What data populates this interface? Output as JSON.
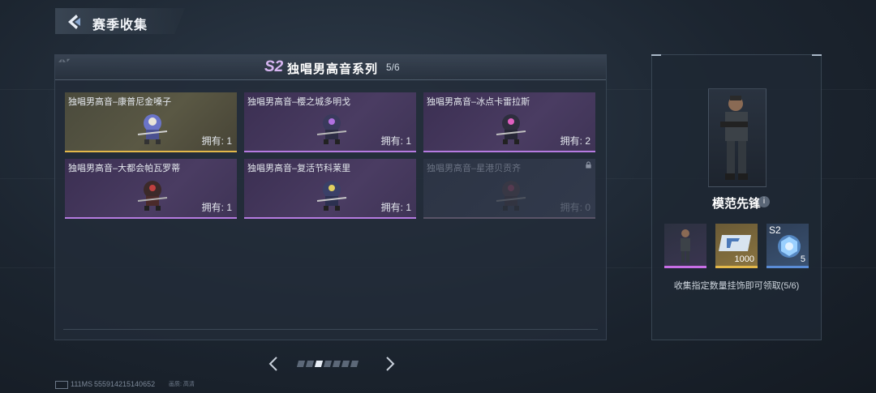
{
  "header": {
    "title": "赛季收集"
  },
  "panel": {
    "season_badge": "S2",
    "title": "独唱男高音系列",
    "count": "5/6"
  },
  "cards": [
    {
      "name": "独唱男高音–康普尼金嗓子",
      "own": "拥有: 1",
      "rarity": "gold",
      "locked": false
    },
    {
      "name": "独唱男高音–樱之城多明戈",
      "own": "拥有: 1",
      "rarity": "purple",
      "locked": false
    },
    {
      "name": "独唱男高音–冰点卡雷拉斯",
      "own": "拥有: 2",
      "rarity": "purple",
      "locked": false
    },
    {
      "name": "独唱男高音–大都会帕瓦罗蒂",
      "own": "拥有: 1",
      "rarity": "purple",
      "locked": false
    },
    {
      "name": "独唱男高音–复活节科莱里",
      "own": "拥有: 1",
      "rarity": "purple",
      "locked": false
    },
    {
      "name": "独唱男高音–星港贝贡齐",
      "own": "拥有: 0",
      "rarity": "purple",
      "locked": true
    }
  ],
  "pagination": {
    "total": 7,
    "active": 3
  },
  "reward": {
    "name": "模范先锋",
    "items": [
      {
        "icon": "character-skin-icon",
        "qty": ""
      },
      {
        "icon": "currency-card-icon",
        "qty": "1000"
      },
      {
        "icon": "season-chest-icon",
        "tag": "S2",
        "qty": "5"
      }
    ],
    "description": "收集指定数量挂饰即可领取(5/6)"
  },
  "footer": {
    "ping": "111MS",
    "id": "555914215140652",
    "quality": "画质: 高清"
  },
  "colors": {
    "gold": "#e3b84a",
    "purple": "#b57be0",
    "blue": "#5a8cd6"
  }
}
